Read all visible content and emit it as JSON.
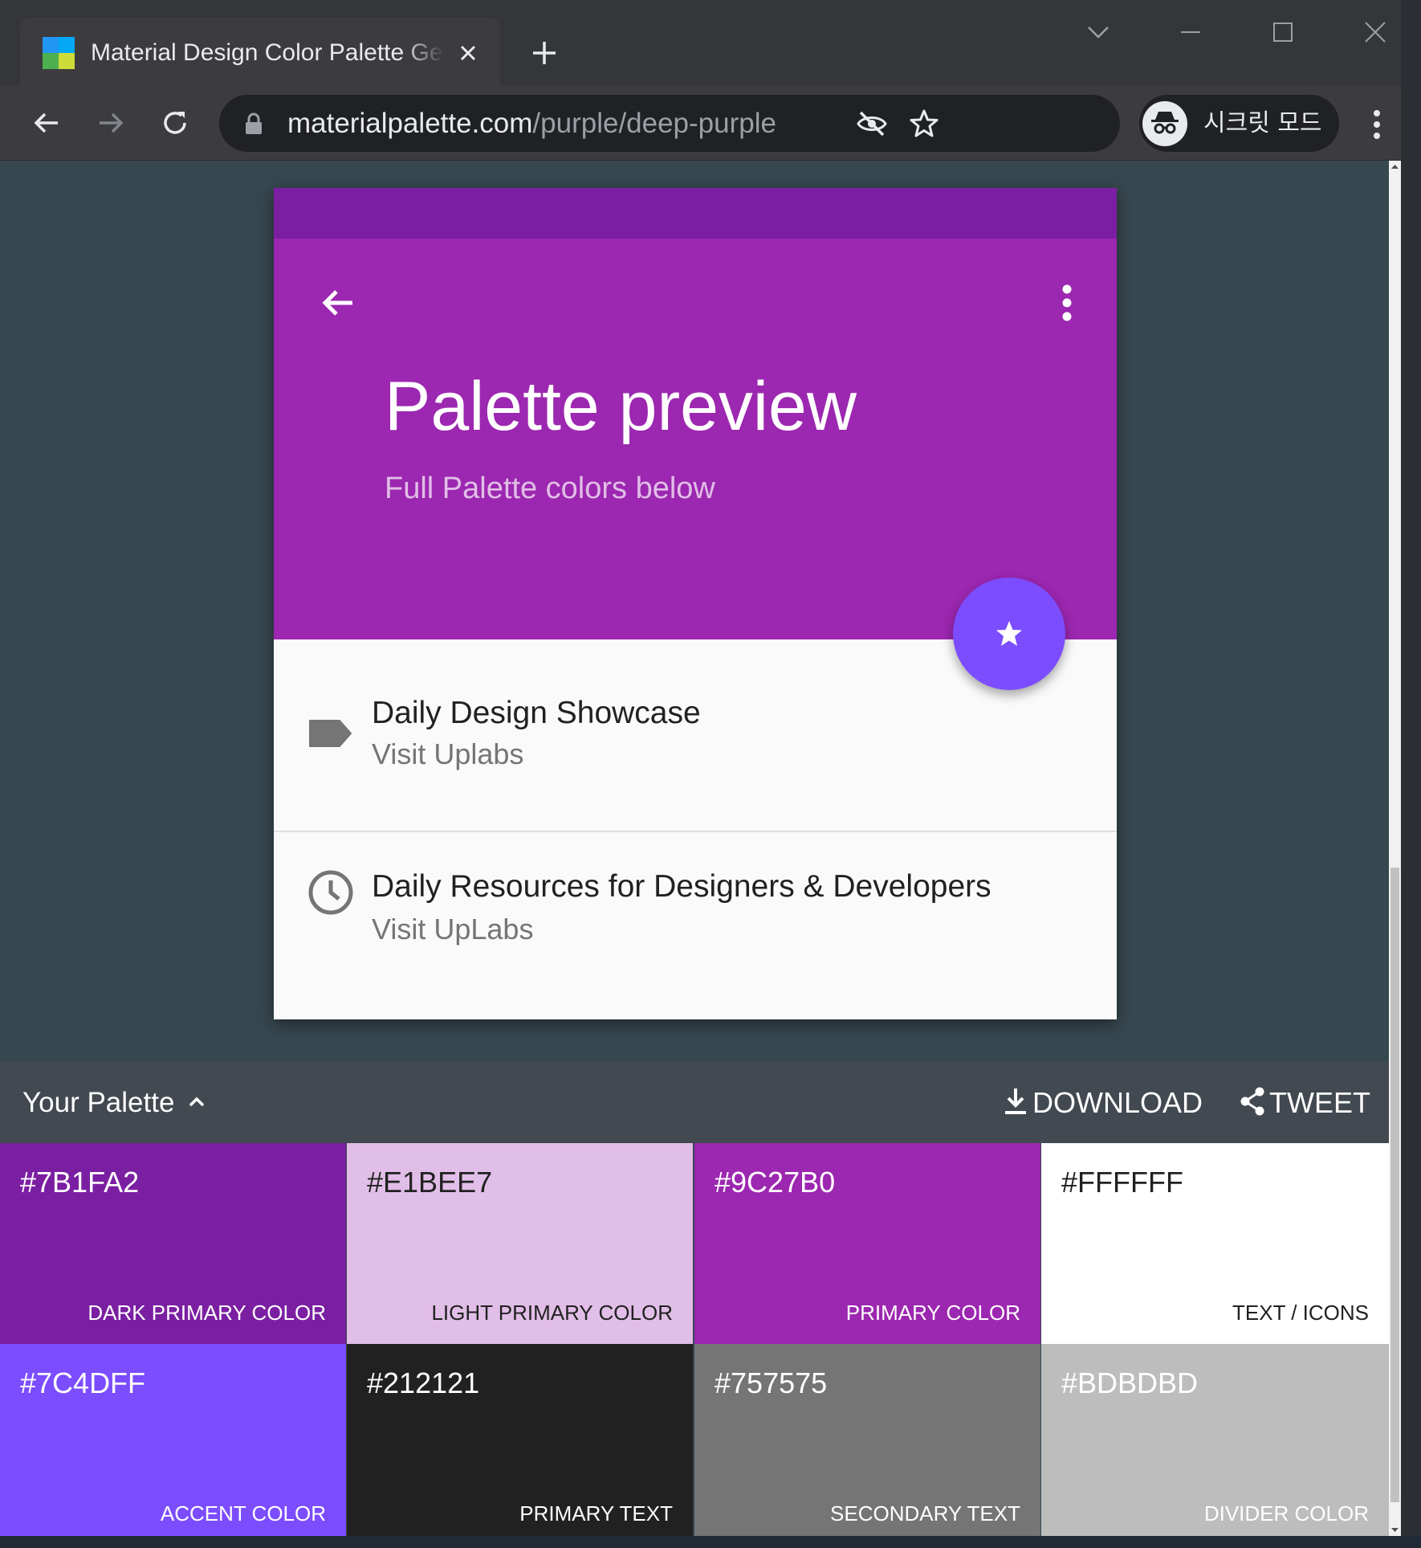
{
  "browser": {
    "tab_title": "Material Design Color Palette Generator",
    "url_domain": "materialpalette.com",
    "url_path": "/purple/deep-purple",
    "incognito_label": "시크릿 모드"
  },
  "preview": {
    "title": "Palette preview",
    "subtitle": "Full Palette colors below",
    "items": [
      {
        "primary": "Daily Design Showcase",
        "secondary": "Visit Uplabs",
        "icon": "label-tag-icon"
      },
      {
        "primary": "Daily Resources for Designers & Developers",
        "secondary": "Visit UpLabs",
        "icon": "clock-icon"
      }
    ]
  },
  "palette": {
    "title": "Your Palette",
    "download_label": "DOWNLOAD",
    "tweet_label": "TWEET",
    "swatches": [
      {
        "hex": "#7B1FA2",
        "label": "DARK PRIMARY COLOR",
        "bg": "#7b1fa2",
        "fg": "#ffffff"
      },
      {
        "hex": "#E1BEE7",
        "label": "LIGHT PRIMARY COLOR",
        "bg": "#e1bee7",
        "fg": "#212121"
      },
      {
        "hex": "#9C27B0",
        "label": "PRIMARY COLOR",
        "bg": "#9c27b0",
        "fg": "#ffffff"
      },
      {
        "hex": "#FFFFFF",
        "label": "TEXT / ICONS",
        "bg": "#ffffff",
        "fg": "#212121"
      },
      {
        "hex": "#7C4DFF",
        "label": "ACCENT COLOR",
        "bg": "#7c4dff",
        "fg": "#ffffff"
      },
      {
        "hex": "#212121",
        "label": "PRIMARY TEXT",
        "bg": "#212121",
        "fg": "#ffffff"
      },
      {
        "hex": "#757575",
        "label": "SECONDARY TEXT",
        "bg": "#757575",
        "fg": "#ffffff"
      },
      {
        "hex": "#BDBDBD",
        "label": "DIVIDER COLOR",
        "bg": "#bdbdbd",
        "fg": "#ffffff"
      }
    ]
  },
  "colors": {
    "primary": "#9c27b0",
    "dark_primary": "#7b1fa2",
    "light_primary": "#e1bee7",
    "accent": "#7c4dff",
    "page_background": "#37474f"
  }
}
